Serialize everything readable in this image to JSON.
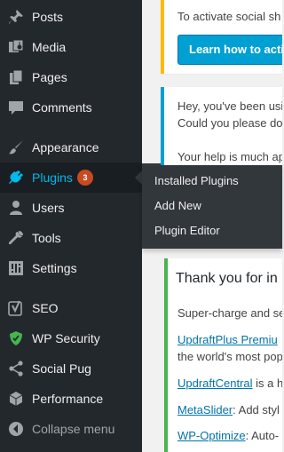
{
  "sidebar": {
    "items": [
      {
        "label": "Posts",
        "icon": "pushpin-icon"
      },
      {
        "label": "Media",
        "icon": "media-icon"
      },
      {
        "label": "Pages",
        "icon": "pages-icon"
      },
      {
        "label": "Comments",
        "icon": "comment-icon"
      },
      {
        "label": "Appearance",
        "icon": "paintbrush-icon"
      },
      {
        "label": "Plugins",
        "icon": "plugin-icon",
        "badge": "3",
        "active": true
      },
      {
        "label": "Users",
        "icon": "user-icon"
      },
      {
        "label": "Tools",
        "icon": "wrench-icon"
      },
      {
        "label": "Settings",
        "icon": "settings-icon"
      },
      {
        "label": "SEO",
        "icon": "yoast-seo-icon"
      },
      {
        "label": "WP Security",
        "icon": "shield-icon"
      },
      {
        "label": "Social Pug",
        "icon": "share-icon"
      },
      {
        "label": "Performance",
        "icon": "performance-icon"
      },
      {
        "label": "Collapse menu",
        "icon": "collapse-arrow-icon"
      }
    ]
  },
  "submenu": {
    "items": [
      "Installed Plugins",
      "Add New",
      "Plugin Editor"
    ]
  },
  "notices": {
    "first": {
      "text": "To activate social sh",
      "button": "Learn how to activ"
    },
    "second": {
      "line1": "Hey, you've been usi",
      "line2": "Could you please do",
      "line3": "Your help is much ap"
    },
    "panel": {
      "title": "Thank you for in",
      "intro": "Super-charge and se",
      "links": [
        {
          "link": "UpdraftPlus Premiu",
          "rest": ""
        },
        {
          "link": "",
          "rest": "the world's most pop"
        },
        {
          "link": "UpdraftCentral",
          "rest": " is a h"
        },
        {
          "link": "MetaSlider",
          "rest": ": Add styl"
        },
        {
          "link": "WP-Optimize",
          "rest": ": Auto-"
        }
      ]
    }
  },
  "colors": {
    "sidebar_bg": "#23282d",
    "submenu_bg": "#32373c",
    "active_text": "#00b9eb",
    "badge_bg": "#ca4a1f",
    "notice_yellow": "#ffb900",
    "notice_blue": "#00a0d2",
    "notice_green": "#46b450",
    "link": "#0073aa"
  }
}
